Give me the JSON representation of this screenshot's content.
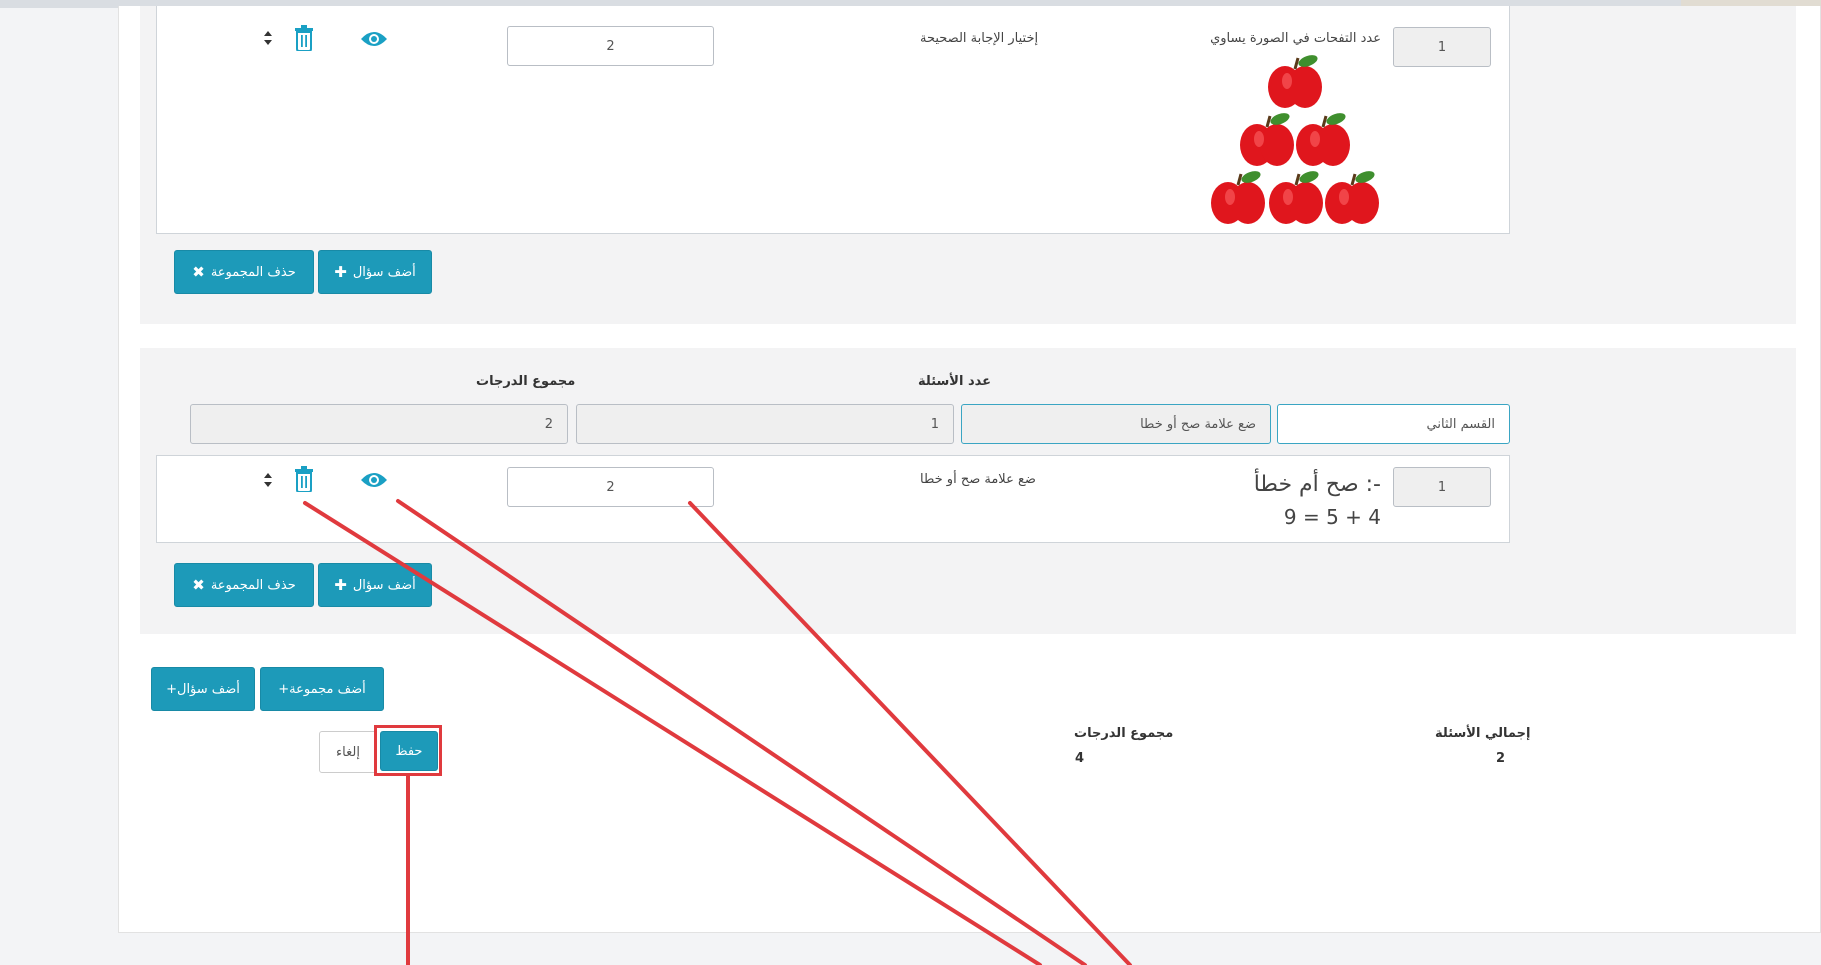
{
  "group1": {
    "question": {
      "number": "1",
      "text": "عدد التفحات في الصورة يساوي",
      "type_label": "إختيار الإجابة الصحيحة",
      "grade": "2"
    },
    "add_question_label": "أضف سؤال",
    "delete_group_label": "حذف المجموعة"
  },
  "group2": {
    "questions_count_header": "عدد الأسئلة",
    "grades_total_header": "مجموع الدرجات",
    "section_name": "القسم الثاني",
    "group_type": "ضع علامة صح أو خطا",
    "questions_count": "1",
    "grades_total": "2",
    "question": {
      "number": "1",
      "title": "صح أم خطأ :-",
      "equation": "9 = 5 + 4",
      "type_label": "ضع علامة صح أو خطا",
      "grade": "2"
    },
    "add_question_label": "أضف سؤال",
    "delete_group_label": "حذف المجموعة"
  },
  "footer": {
    "add_group_label": "+أضف مجموعة",
    "add_question_label": "+أضف سؤال",
    "total_questions_label": "إجمالي الأسئلة",
    "total_questions_value": "2",
    "total_grades_label": "مجموع الدرجات",
    "total_grades_value": "4",
    "save_label": "حفظ",
    "cancel_label": "إلغاء"
  },
  "colors": {
    "primary_button": "#1d9ab9",
    "annotation_red": "#e03a3e",
    "apple_red": "#e0161d",
    "leaf_green": "#3f8f2e"
  },
  "icons": {
    "view": "eye-icon",
    "delete": "trash-icon",
    "reorder": "sort-icon",
    "add": "plus-icon",
    "remove": "times-icon"
  }
}
